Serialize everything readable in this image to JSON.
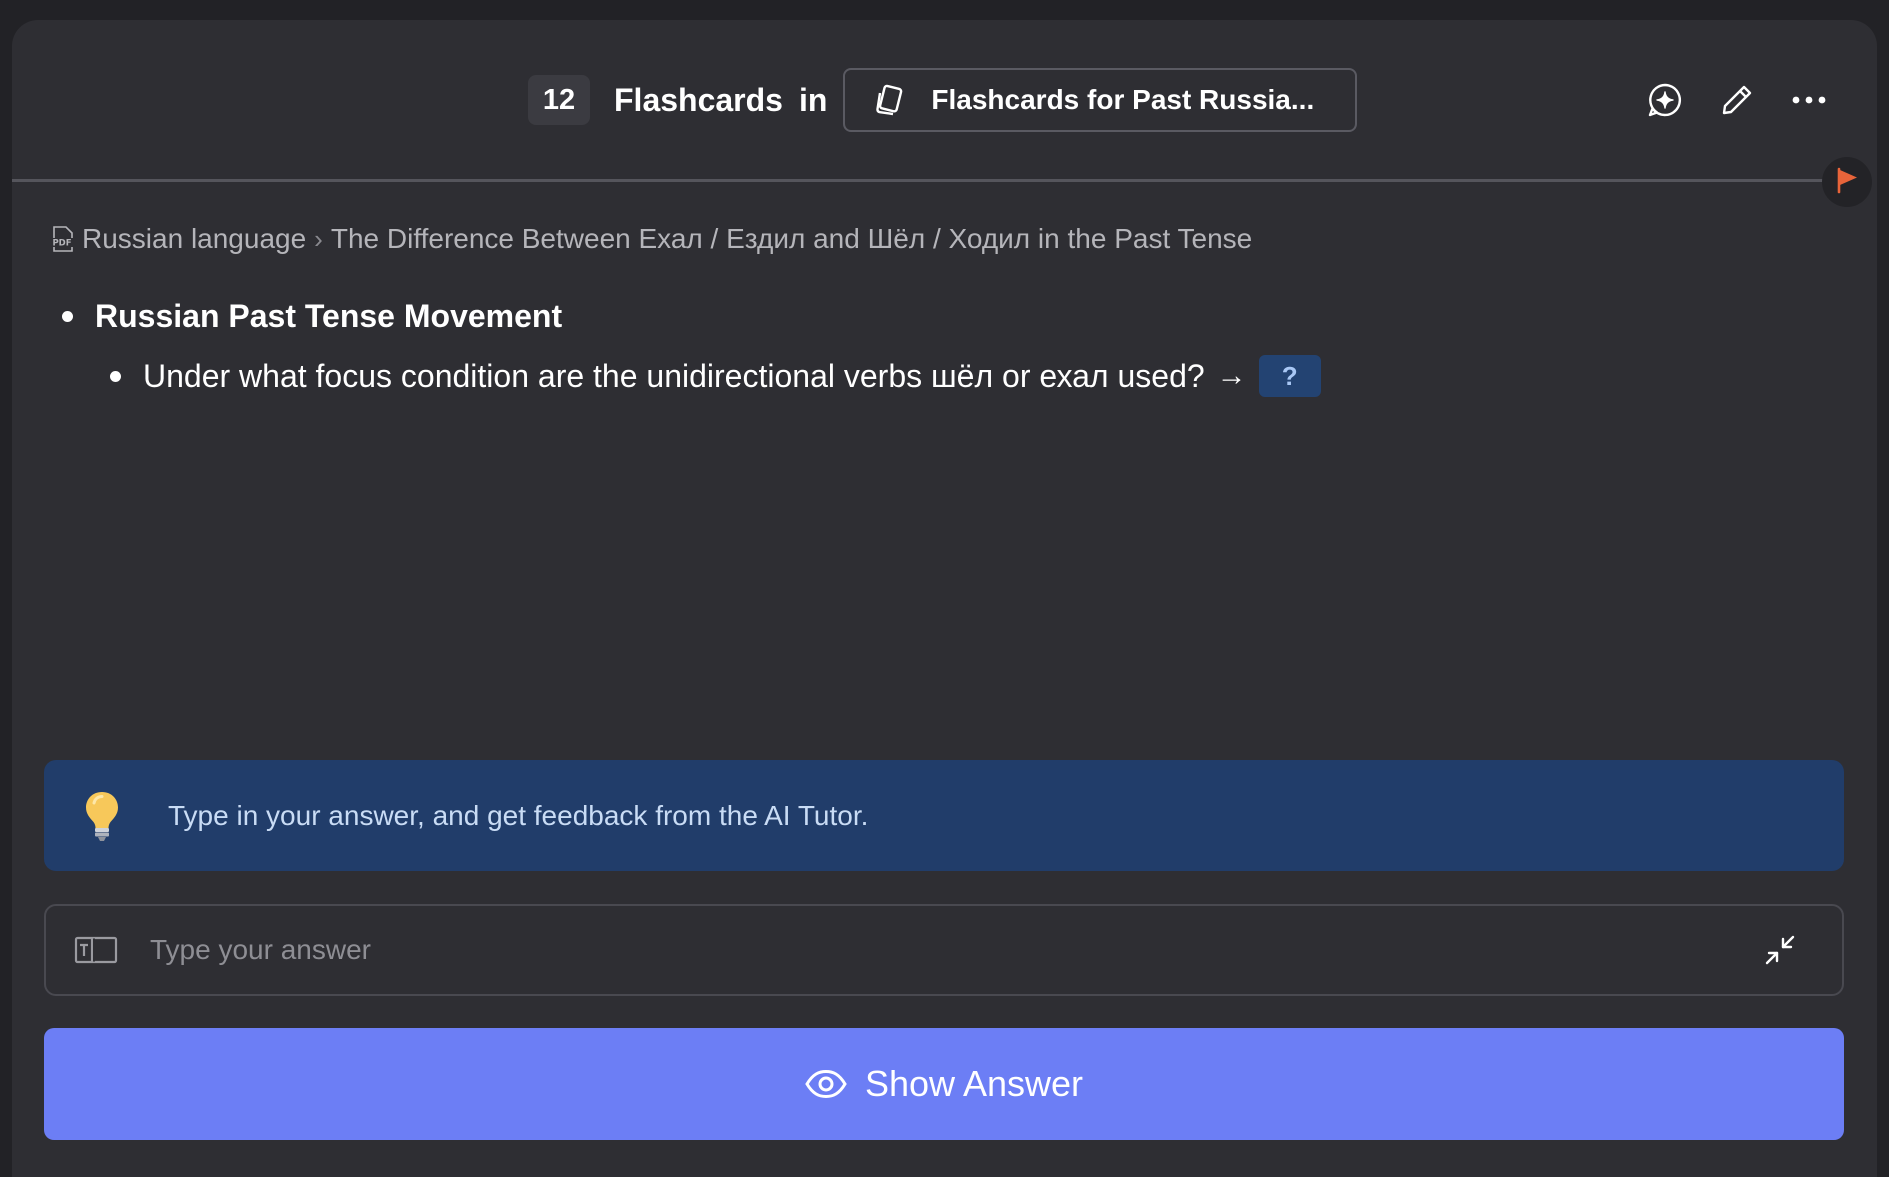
{
  "header": {
    "count": "12",
    "word": "Flashcards",
    "in": "in",
    "deck_title": "Flashcards for Past Russia..."
  },
  "breadcrumb": {
    "source": "Russian language",
    "separator": "›",
    "document": "The Difference Between Ехал / Ездил and Шёл / Ходил in the Past Tense"
  },
  "card": {
    "topic": "Russian Past Tense Movement",
    "question": "Under what focus condition are the unidirectional verbs шёл or ехал used?",
    "arrow": "→",
    "cloze": "?"
  },
  "tip": {
    "text": "Type in your answer, and get feedback from the AI Tutor."
  },
  "answer": {
    "placeholder": "Type your answer",
    "value": ""
  },
  "show_answer": {
    "label": "Show Answer"
  },
  "colors": {
    "background": "#222226",
    "panel": "#2e2e33",
    "tip_banner": "#213d6a",
    "cloze_bg": "#234372",
    "primary_button": "#6c7ef5",
    "flag": "#e8643a"
  },
  "icons": {
    "deck": "cards-icon",
    "add": "sparkle-add-icon",
    "edit": "pencil-icon",
    "more": "more-horizontal-icon",
    "flag": "flag-icon",
    "pdf": "pdf-icon",
    "tip": "lightbulb-icon",
    "input_mode": "text-mode-icon",
    "collapse": "collapse-icon",
    "show": "eye-icon"
  }
}
